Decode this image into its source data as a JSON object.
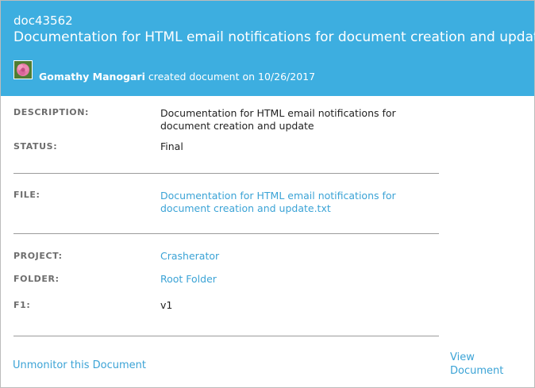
{
  "document": {
    "id": "doc43562",
    "title": "Documentation for HTML email notifications for document creation and update"
  },
  "byline": {
    "author": "Gomathy Manogari",
    "action": " created document on ",
    "date": "10/26/2017"
  },
  "fields": {
    "description": {
      "label": "DESCRIPTION:",
      "value": "Documentation for HTML email notifications for document creation and update"
    },
    "status": {
      "label": "STATUS:",
      "value": "Final"
    },
    "file": {
      "label": "FILE:",
      "value": "Documentation for HTML email notifications for document creation and update.txt"
    },
    "project": {
      "label": "PROJECT:",
      "value": "Crasherator"
    },
    "folder": {
      "label": "FOLDER:",
      "value": "Root Folder"
    },
    "f1": {
      "label": "F1:",
      "value": "v1"
    }
  },
  "actions": {
    "unmonitor": "Unmonitor this Document",
    "view": "View Document"
  },
  "colors": {
    "header": "#3daee0",
    "link": "#3ba3d6",
    "label": "#6d6d6d"
  }
}
